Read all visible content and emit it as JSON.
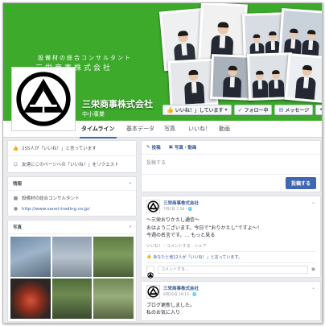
{
  "cover": {
    "tagline": "設備材の総合コンサルタント",
    "name_text": "三栄商事株式会社",
    "bg_color": "#3daa2c"
  },
  "page": {
    "title": "三栄商事株式会社",
    "category": "中小事業"
  },
  "actions": {
    "like": "いいね！」しています",
    "follow": "フォロー中",
    "message": "メッセージ",
    "more": "•••"
  },
  "tabs": [
    "タイムライン",
    "基本データ",
    "写真",
    "いいね！",
    "動画"
  ],
  "left": {
    "likes_count": "255人が「いいね！」と言っています",
    "invite": "友達にこのページへの「いいね！」をリクエスト",
    "info_header": "情報",
    "info_desc": "設備材の総合コンサルタント",
    "website": "http://www.sanei-trading.co.jp/",
    "photos_header": "写真"
  },
  "composer": {
    "tab_post": "投稿",
    "tab_photo": "写真・動画",
    "placeholder": "投稿する",
    "submit": "投稿する"
  },
  "posts": [
    {
      "author": "三栄商事株式会社",
      "time": "7月1日 7:58 · ",
      "lines": [
        "～三栄おりかえし通信～",
        "おはようございます。今日で“おりかえし”ですよ～！",
        "今週の名言です。… もっと見る"
      ],
      "actions": "いいね！ · コメントする · シェア",
      "likes": "あなたと他12人が「いいね！」と言っています。",
      "comment_placeholder": "コメントする..."
    },
    {
      "author": "三栄商事株式会社",
      "time": "6月26日 19:15 · ",
      "lines": [
        "ブログ更新しました。",
        "私のお気に入り"
      ]
    }
  ],
  "icons": {
    "likes": "like-icon",
    "invite": "invite-icon",
    "info_desc": "briefcase-icon",
    "website": "globe-icon",
    "logo": "sanei-logo"
  }
}
